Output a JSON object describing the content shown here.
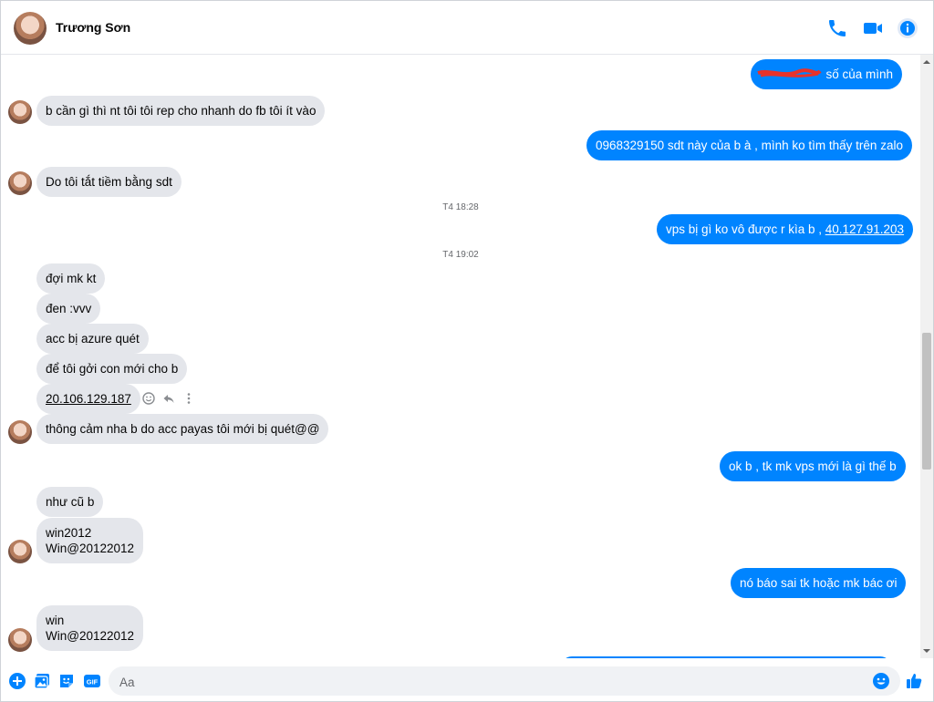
{
  "header": {
    "contact_name": "Trương Sơn",
    "icons": [
      "phone-icon",
      "video-icon",
      "info-icon"
    ]
  },
  "colors": {
    "accent": "#0084ff",
    "incoming_bubble": "#e4e6eb",
    "outgoing_text": "#ffffff"
  },
  "messages": [
    {
      "dir": "out",
      "text": "số của mình",
      "redacted_prefix": true
    },
    {
      "dir": "in",
      "text": "b cần gì thì nt tôi tôi rep cho nhanh do fb tôi ít vào"
    },
    {
      "dir": "out",
      "text": "0968329150 sdt này của b à , mình ko tìm thấy trên zalo"
    },
    {
      "dir": "in",
      "text": "Do tôi tắt tiềm bằng sdt"
    },
    {
      "dir": "ts",
      "text": "T4 18:28"
    },
    {
      "dir": "out",
      "text": "vps bị gì ko vô được r kìa b , ",
      "link": "40.127.91.203"
    },
    {
      "dir": "ts",
      "text": "T4 19:02"
    },
    {
      "dir": "in",
      "text": "đợi mk kt"
    },
    {
      "dir": "in",
      "text": "đen :vvv"
    },
    {
      "dir": "in",
      "text": "acc bị azure quét"
    },
    {
      "dir": "in",
      "text": "để tôi gởi con mới cho b"
    },
    {
      "dir": "in",
      "link": "20.106.129.187"
    },
    {
      "dir": "in",
      "text": "thông cảm nha b do acc payas tôi mới bị quét@@"
    },
    {
      "dir": "out",
      "text": "ok b , tk mk vps mới là gì thế b"
    },
    {
      "dir": "in",
      "text": "như cũ b"
    },
    {
      "dir": "in",
      "lines": [
        "win2012",
        "Win@20122012"
      ]
    },
    {
      "dir": "out",
      "text": "nó báo sai tk hoặc mk bác ơi"
    },
    {
      "dir": "in",
      "lines": [
        "win",
        "Win@20122012"
      ]
    }
  ],
  "composer": {
    "placeholder": "Aa",
    "icons": [
      "plus-icon",
      "image-icon",
      "sticker-icon",
      "gif-icon",
      "emoji-icon",
      "like-icon"
    ],
    "gif_label": "GIF"
  }
}
